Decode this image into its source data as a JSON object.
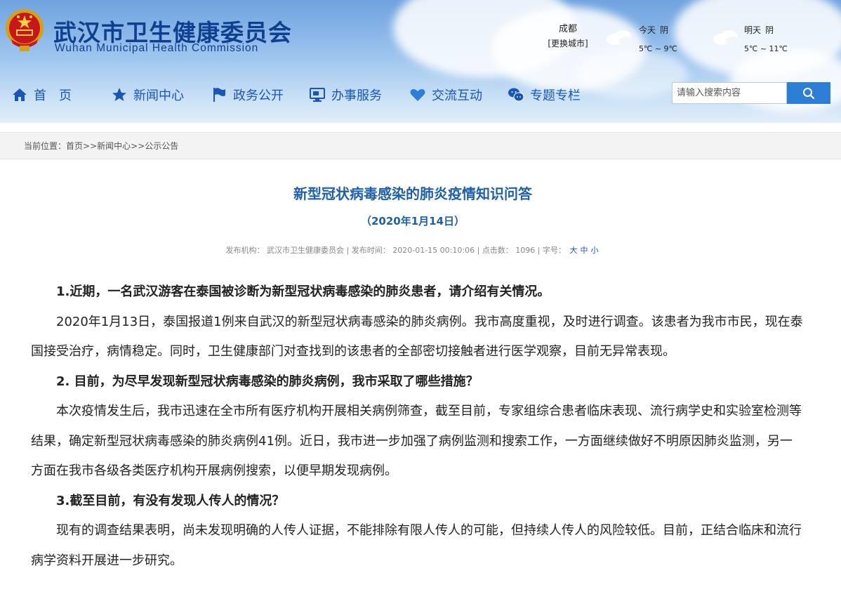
{
  "header": {
    "title": "武汉市卫生健康委员会",
    "subtitle": "Wuhan Municipal Health Commission"
  },
  "weather": {
    "city": "成都",
    "change_city": "[更换城市]",
    "today": {
      "label": "今天",
      "cond": "阴",
      "temp": "5℃ ~ 9℃"
    },
    "tomorrow": {
      "label": "明天",
      "cond": "阴",
      "temp": "5℃ ~ 11℃"
    }
  },
  "nav": {
    "items": [
      {
        "label": "首　页",
        "icon": "home-icon"
      },
      {
        "label": "新闻中心",
        "icon": "star-icon"
      },
      {
        "label": "政务公开",
        "icon": "flag-icon"
      },
      {
        "label": "办事服务",
        "icon": "monitor-icon"
      },
      {
        "label": "交流互动",
        "icon": "heart-icon"
      },
      {
        "label": "专题专栏",
        "icon": "chat-icon"
      }
    ],
    "search_placeholder": "请输入搜索内容"
  },
  "breadcrumb": {
    "prefix": "当前位置：",
    "items": [
      "首页",
      "新闻中心",
      "公示公告"
    ],
    "sep": ">>"
  },
  "article": {
    "title": "新型冠状病毒感染的肺炎疫情知识问答",
    "date": "（2020年1月14日）",
    "meta": {
      "publisher_label": "发布机构：",
      "publisher": "武汉市卫生健康委员会",
      "time_label": "| 发布时间：",
      "time": "2020-01-15 00:10:06",
      "clicks_label": "| 点击数：",
      "clicks": "1096",
      "font_label": "| 字号：",
      "font_sizes": [
        "大",
        "中",
        "小"
      ]
    },
    "paragraphs": [
      {
        "type": "q",
        "text": "1.近期，一名武汉游客在泰国被诊断为新型冠状病毒感染的肺炎患者，请介绍有关情况。"
      },
      {
        "type": "a",
        "text": "2020年1月13日，泰国报道1例来自武汉的新型冠状病毒感染的肺炎病例。我市高度重视，及时进行调查。该患者为我市市民，现在泰国接受治疗，病情稳定。同时，卫生健康部门对查找到的该患者的全部密切接触者进行医学观察，目前无异常表现。"
      },
      {
        "type": "q",
        "text": "2. 目前，为尽早发现新型冠状病毒感染的肺炎病例，我市采取了哪些措施？"
      },
      {
        "type": "a",
        "text": "本次疫情发生后，我市迅速在全市所有医疗机构开展相关病例筛查，截至目前，专家组综合患者临床表现、流行病学史和实验室检测等结果，确定新型冠状病毒感染的肺炎病例41例。近日，我市进一步加强了病例监测和搜索工作，一方面继续做好不明原因肺炎监测，另一方面在我市各级各类医疗机构开展病例搜索，以便早期发现病例。"
      },
      {
        "type": "q",
        "text": "3.截至目前，有没有发现人传人的情况？"
      },
      {
        "type": "a",
        "text": "现有的调查结果表明，尚未发现明确的人传人证据，不能排除有限人传人的可能，但持续人传人的风险较低。目前，正结合临床和流行病学资料开展进一步研究。"
      }
    ]
  }
}
